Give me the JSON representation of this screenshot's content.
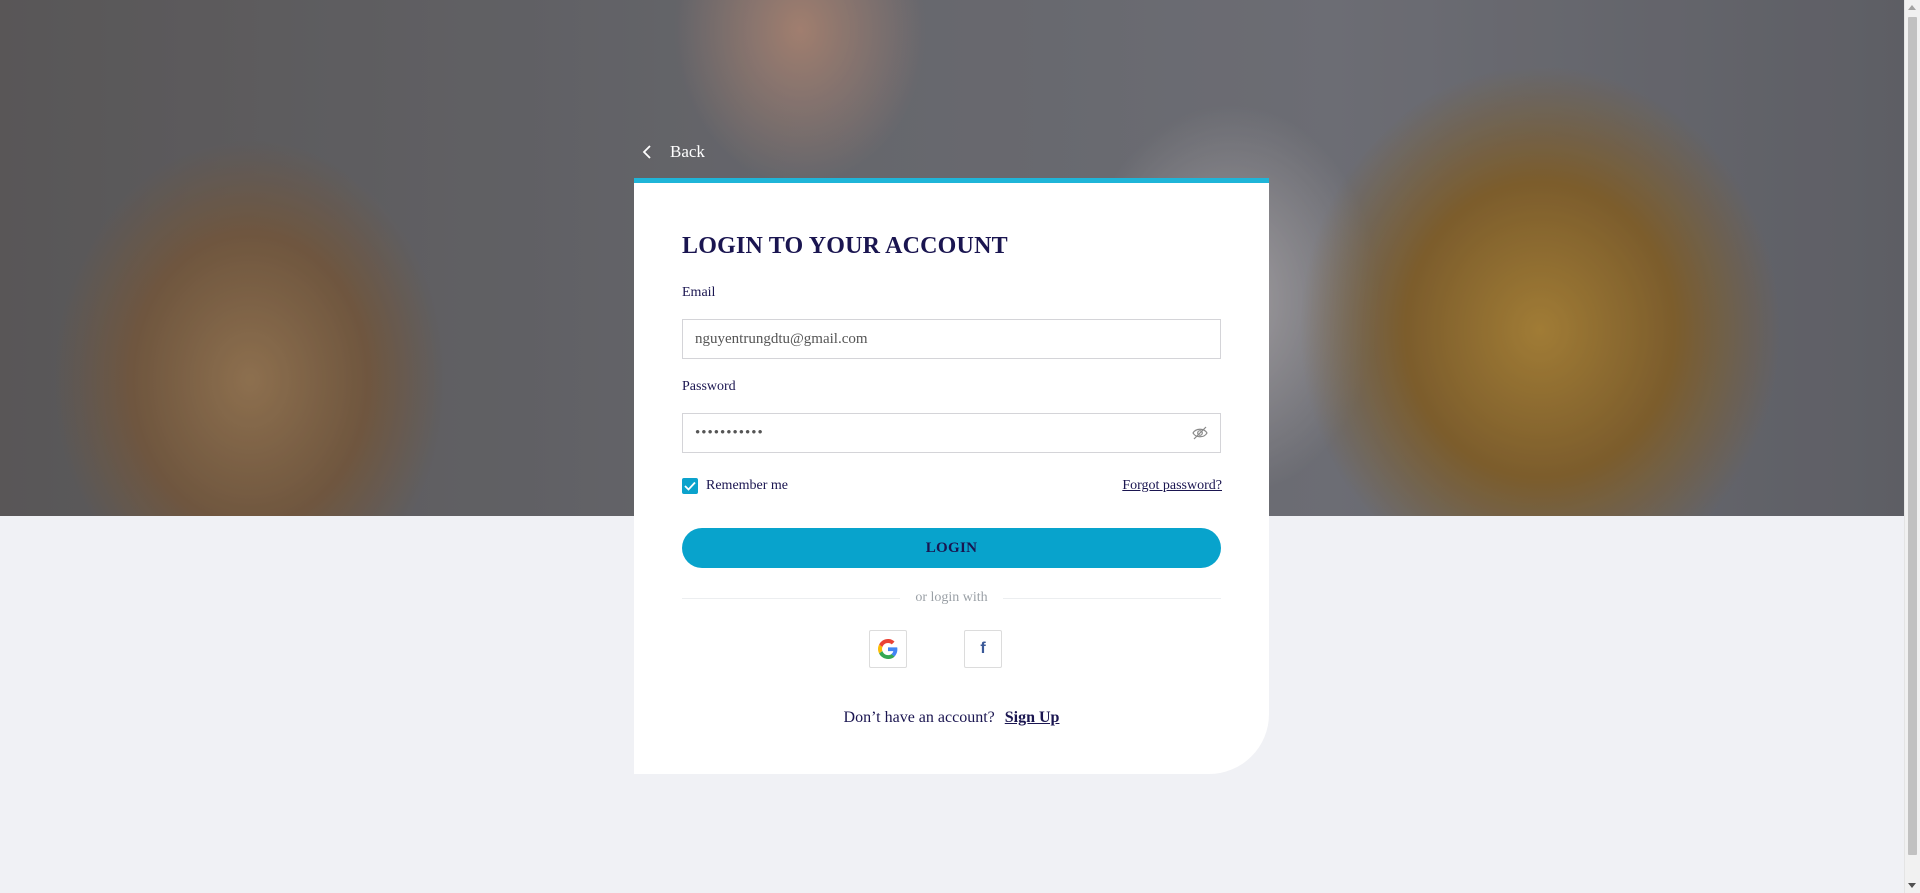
{
  "back": {
    "label": "Back"
  },
  "login": {
    "title": "LOGIN TO YOUR ACCOUNT",
    "email_label": "Email",
    "email_value": "nguyentrungdtu@gmail.com",
    "password_label": "Password",
    "password_value": "•••••••••••",
    "remember_label": "Remember me",
    "remember_checked": true,
    "forgot_label": "Forgot password?",
    "submit_label": "LOGIN",
    "divider_text": "or login with",
    "social": [
      "google-icon",
      "facebook-icon"
    ],
    "facebook_glyph": "f",
    "signup_prompt": "Don’t have an account?",
    "signup_link": "Sign Up"
  },
  "colors": {
    "accent": "#08a3cc",
    "text": "#1a1550",
    "card_top_border": "#1fb5d8",
    "page_bg": "#f0f1f5"
  }
}
